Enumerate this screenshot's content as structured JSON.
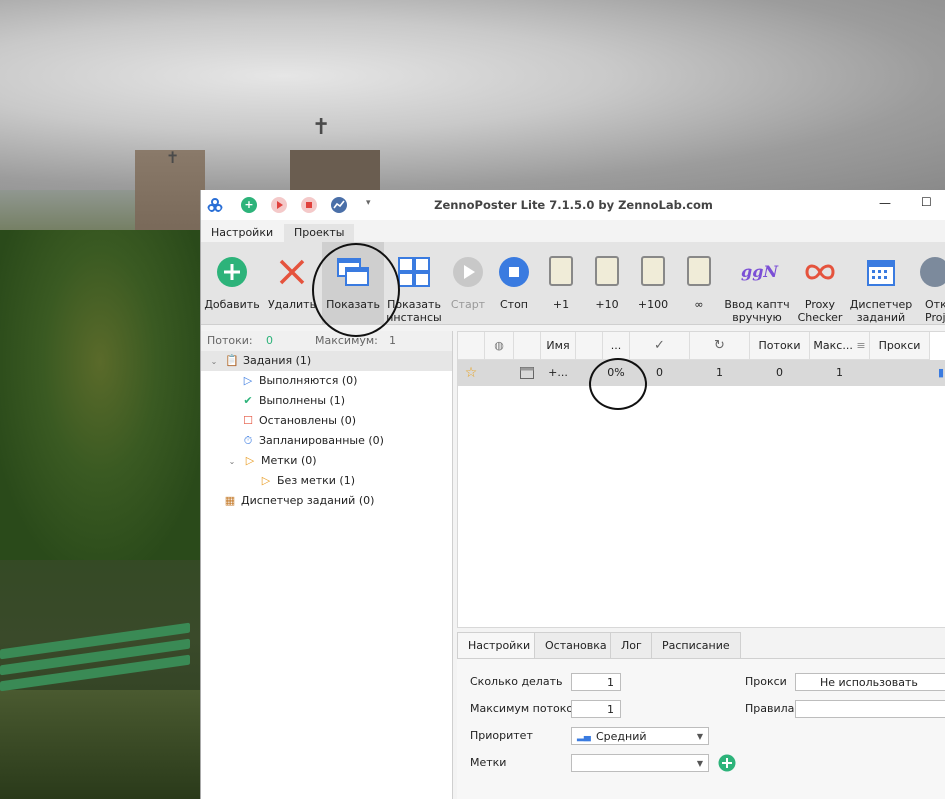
{
  "window": {
    "title": "ZennoPoster Lite 7.1.5.0 by ZennoLab.com",
    "window_controls": {
      "minimize": "—",
      "maximize": "☐"
    }
  },
  "menu_tabs": [
    "Настройки",
    "Проекты"
  ],
  "ribbon": {
    "buttons": [
      {
        "label": "Добавить",
        "icon": "add-icon"
      },
      {
        "label": "Удалить",
        "icon": "delete-icon"
      },
      {
        "label": "Показать",
        "icon": "show-window-icon"
      },
      {
        "label": "Показать\nинстансы",
        "icon": "show-instances-icon"
      },
      {
        "label": "Старт",
        "icon": "start-icon"
      },
      {
        "label": "Стоп",
        "icon": "stop-icon"
      },
      {
        "label": "+1",
        "icon": "clipboard-icon"
      },
      {
        "label": "+10",
        "icon": "clipboard-icon"
      },
      {
        "label": "+100",
        "icon": "clipboard-icon"
      },
      {
        "label": "∞",
        "icon": "clipboard-icon"
      },
      {
        "label": "Ввод каптч\nвручную",
        "icon": "captcha-icon"
      },
      {
        "label": "Proxy\nChecker",
        "icon": "proxy-checker-icon"
      },
      {
        "label": "Диспетчер\nзаданий",
        "icon": "scheduler-icon"
      },
      {
        "label": "Отк\nProje",
        "icon": "open-project-icon"
      }
    ]
  },
  "left_panel": {
    "threads_label": "Потоки:",
    "threads_value": "0",
    "max_label": "Максимум:",
    "max_value": "1",
    "tree": [
      {
        "label": "Задания (1)"
      },
      {
        "label": "Выполняются (0)"
      },
      {
        "label": "Выполнены (1)"
      },
      {
        "label": "Остановлены (0)"
      },
      {
        "label": "Запланированные (0)"
      },
      {
        "label": "Метки (0)"
      },
      {
        "label": "Без метки (1)"
      },
      {
        "label": "Диспетчер заданий (0)"
      }
    ]
  },
  "grid": {
    "columns": [
      "",
      "",
      "",
      "Имя",
      "",
      "...",
      "",
      "",
      "Потоки",
      "Макс...",
      "Прокси"
    ],
    "rows": [
      {
        "name": "+...",
        "progress": "0%",
        "done": "0",
        "repeat": "1",
        "threads": "0",
        "max": "1"
      }
    ]
  },
  "bottom": {
    "tabs": [
      "Настройки",
      "Остановка",
      "Лог",
      "Расписание"
    ],
    "fields": {
      "count_label": "Сколько делать",
      "count_value": "1",
      "max_threads_label": "Максимум потоков",
      "max_threads_value": "1",
      "priority_label": "Приоритет",
      "priority_value": "Средний",
      "tags_label": "Метки",
      "tags_value": "",
      "proxy_label": "Прокси",
      "proxy_value": "Не использовать",
      "rules_label": "Правила",
      "rules_value": ""
    }
  },
  "colors": {
    "accent_green": "#2db37a",
    "stop_blue": "#3a7be0",
    "delete_red": "#e5533d"
  }
}
